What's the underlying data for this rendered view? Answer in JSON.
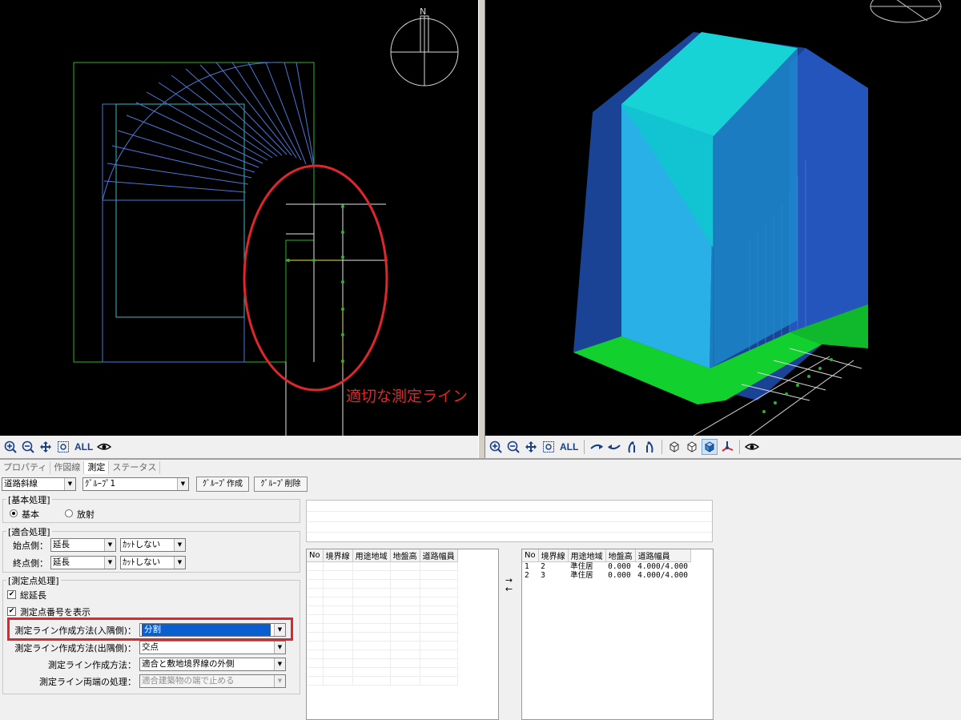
{
  "viewport_left": {
    "annotation": "適切な測定ライン",
    "compass_label": "N"
  },
  "toolbar_left": {
    "all_label": "ALL",
    "icons": [
      "zoom-in-icon",
      "zoom-out-icon",
      "pan-icon",
      "zoom-window-icon",
      "eye-icon"
    ]
  },
  "toolbar_right": {
    "all_label": "ALL",
    "icons": [
      "zoom-in-icon",
      "zoom-out-icon",
      "pan-icon",
      "zoom-window-icon",
      "rotate-left-icon",
      "rotate-right-icon",
      "rotate-up-icon",
      "rotate-down-icon",
      "wireframe-cube-icon",
      "hidden-cube-icon",
      "shaded-cube-icon",
      "axis-icon",
      "eye-icon"
    ]
  },
  "tabs": [
    {
      "label": "プロパティ",
      "active": false
    },
    {
      "label": "作図線",
      "active": false
    },
    {
      "label": "測定",
      "active": true
    },
    {
      "label": "ステータス",
      "active": false
    }
  ],
  "top_controls": {
    "line_type": "道路斜線",
    "group": "ｸﾞﾙｰﾌﾟ1",
    "create_group": "ｸﾞﾙｰﾌﾟ作成",
    "delete_group": "ｸﾞﾙｰﾌﾟ削除"
  },
  "basic": {
    "title": "[基本処理]",
    "option_basic": "基本",
    "option_radial": "放射",
    "selected": "基本"
  },
  "fit": {
    "title": "[適合処理]",
    "start_label": "始点側：",
    "end_label": "終点側：",
    "start_extend": "延長",
    "start_cut": "ｶｯﾄしない",
    "end_extend": "延長",
    "end_cut": "ｶｯﾄしない"
  },
  "measure": {
    "title": "[測定点処理]",
    "total_length": "総延長",
    "total_length_checked": true,
    "show_numbers": "測定点番号を表示",
    "show_numbers_checked": true,
    "method_in_label": "測定ライン作成方法(入隅側)：",
    "method_in_value": "分割",
    "method_out_label": "測定ライン作成方法(出隅側)：",
    "method_out_value": "交点",
    "method_label": "測定ライン作成方法：",
    "method_value": "適合と敷地境界線の外側",
    "ends_label": "測定ライン両端の処理：",
    "ends_value": "適合建築物の端で止める"
  },
  "table_left": {
    "columns": [
      "No",
      "境界線",
      "用途地域",
      "地盤高",
      "道路幅員"
    ],
    "rows": []
  },
  "transfer": {
    "right_arrow": "→",
    "left_arrow": "←"
  },
  "table_right": {
    "columns": [
      "No",
      "境界線",
      "用途地域",
      "地盤高",
      "道路幅員"
    ],
    "rows": [
      [
        "1",
        "2",
        "準住居",
        "0.000",
        "4.000/4.000"
      ],
      [
        "2",
        "3",
        "準住居",
        "0.000",
        "4.000/4.000"
      ]
    ]
  },
  "colors": {
    "annotation_red": "#e0262b",
    "selection_blue": "#0a5fd0",
    "cad_green": "#2db52d",
    "cad_blue": "#4a78d8",
    "building_cyan": "#17d3d6",
    "slant_blue": "#1f4fb0"
  }
}
